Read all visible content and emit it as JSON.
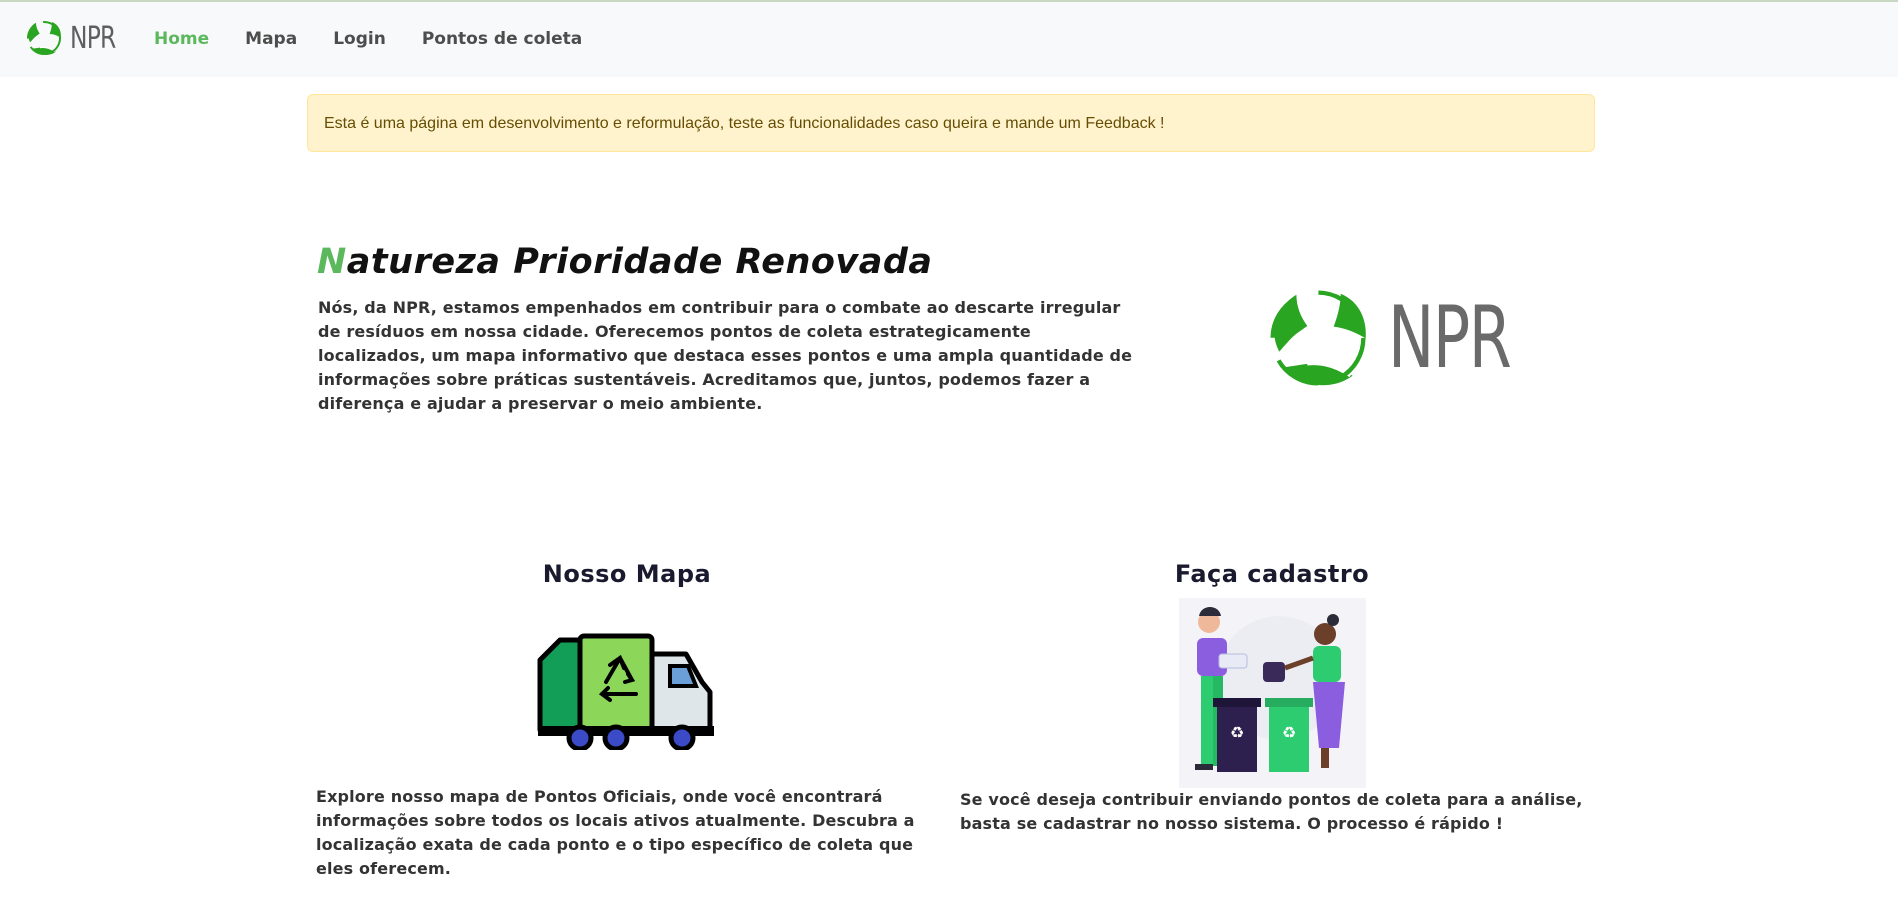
{
  "navbar": {
    "brand": "NPR",
    "links": [
      "Home",
      "Mapa",
      "Login",
      "Pontos de coleta"
    ],
    "active_index": 0
  },
  "alert": {
    "text": "Esta é uma página em desenvolvimento e reformulação, teste as funcionalidades caso queira e mande um Feedback !"
  },
  "hero": {
    "title_first": "N",
    "title_rest": "atureza Prioridade Renovada",
    "text": "Nós, da NPR, estamos empenhados em contribuir para o combate ao descarte irregular de resíduos em nossa cidade. Oferecemos pontos de coleta estrategicamente localizados, um mapa informativo que destaca esses pontos e uma ampla quantidade de informações sobre práticas sustentáveis. Acreditamos que, juntos, podemos fazer a diferença e ajudar a preservar o meio ambiente.",
    "logo_text": "NPR"
  },
  "cards": [
    {
      "title": "Nosso Mapa",
      "icon": "recycling-truck-icon",
      "text": "Explore nosso mapa de Pontos Oficiais, onde você encontrará informações sobre todos os locais ativos atualmente. Descubra a localização exata de cada ponto e o tipo específico de coleta que eles oferecem."
    },
    {
      "title": "Faça cadastro",
      "icon": "people-recycling-illustration",
      "text": "Se você deseja contribuir enviando pontos de coleta para a análise, basta se cadastrar no nosso sistema. O processo é rápido !"
    }
  ],
  "colors": {
    "accent_green": "#5cb85c",
    "logo_green": "#2aa521",
    "alert_bg": "#fff3cd",
    "navbar_bg": "#f8f9fa"
  }
}
